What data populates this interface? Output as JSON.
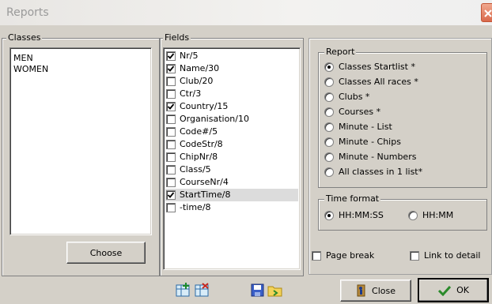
{
  "window": {
    "title": "Reports"
  },
  "classes": {
    "label": "Classes",
    "items": [
      "MEN",
      "WOMEN"
    ],
    "choose_button": "Choose"
  },
  "fields": {
    "label": "Fields",
    "items": [
      {
        "label": "Nr/5",
        "checked": true
      },
      {
        "label": "Name/30",
        "checked": true
      },
      {
        "label": "Club/20",
        "checked": false
      },
      {
        "label": "Ctr/3",
        "checked": false
      },
      {
        "label": "Country/15",
        "checked": true
      },
      {
        "label": "Organisation/10",
        "checked": false
      },
      {
        "label": "Code#/5",
        "checked": false
      },
      {
        "label": "CodeStr/8",
        "checked": false
      },
      {
        "label": "ChipNr/8",
        "checked": false
      },
      {
        "label": "Class/5",
        "checked": false
      },
      {
        "label": "CourseNr/4",
        "checked": false
      },
      {
        "label": "StartTime/8",
        "checked": true,
        "selected": true
      },
      {
        "label": "-time/8",
        "checked": false
      }
    ]
  },
  "report": {
    "label": "Report",
    "options": [
      {
        "label": "Classes Startlist *",
        "selected": true
      },
      {
        "label": "Classes All races *",
        "selected": false
      },
      {
        "label": "Clubs *",
        "selected": false
      },
      {
        "label": "Courses *",
        "selected": false
      },
      {
        "label": "Minute - List",
        "selected": false
      },
      {
        "label": "Minute - Chips",
        "selected": false
      },
      {
        "label": "Minute - Numbers",
        "selected": false
      },
      {
        "label": "All classes in 1 list*",
        "selected": false
      }
    ]
  },
  "time_format": {
    "label": "Time format",
    "options": [
      {
        "label": "HH:MM:SS",
        "selected": true
      },
      {
        "label": "HH:MM",
        "selected": false
      }
    ]
  },
  "options": {
    "page_break": "Page break",
    "link_to_detail": "Link to detail"
  },
  "buttons": {
    "close": "Close",
    "ok": "OK"
  },
  "colors": {
    "dialog_bg": "#d4d0c8",
    "selection": "#dcdcdc",
    "ok_check": "#2a8a2a"
  }
}
